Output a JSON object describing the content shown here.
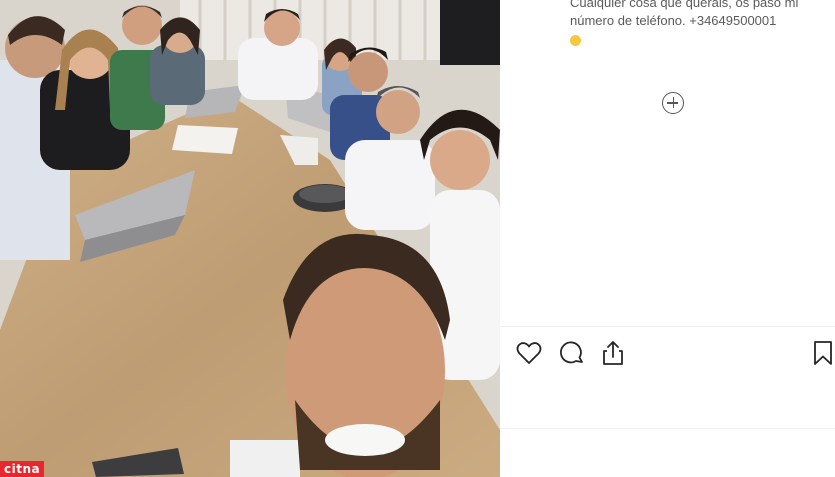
{
  "post": {
    "caption_line1": "Cualquier cosa que queráis, os paso mi",
    "caption_line2": "número de teléfono. +34649500001"
  },
  "icons": {
    "add_comment": "plus-circle-icon",
    "like": "heart-icon",
    "comment": "speech-bubble-icon",
    "share": "share-upload-icon",
    "save": "bookmark-icon"
  },
  "watermark": {
    "text": "citna"
  },
  "colors": {
    "icon": "#262626",
    "caption": "#5a5a5a",
    "watermark_bg": "#e8262d"
  }
}
